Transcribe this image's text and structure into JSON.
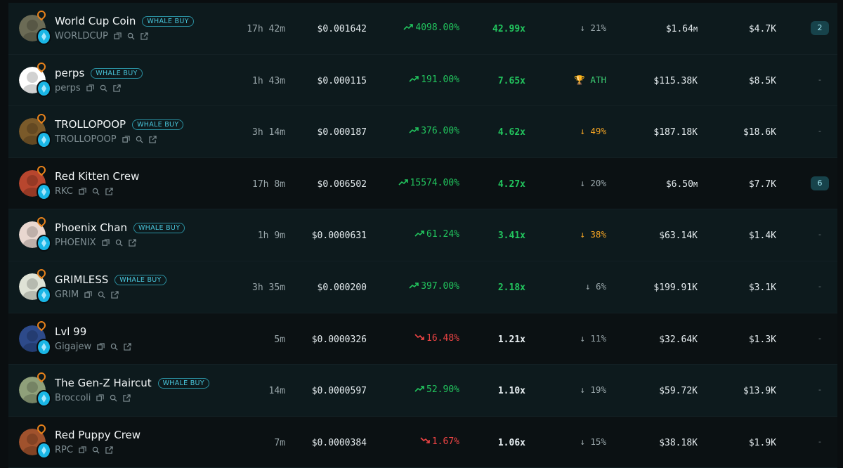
{
  "rows": [
    {
      "name": "World Cup Coin",
      "badge": "WHALE BUY",
      "ticker": "WORLDCUP",
      "age": "17h 42m",
      "price": "$0.001642",
      "change": "4098.00%",
      "dir": "up",
      "multiple": "42.99x",
      "mult_green": true,
      "drawdown": "↓ 21%",
      "dd_style": "gray",
      "mcap": "$1.64",
      "mcap_unit": "M",
      "volume": "$4.7K",
      "count": "2",
      "avatar_color": "#6b6b55",
      "tint": "tint"
    },
    {
      "name": "perps",
      "badge": "WHALE BUY",
      "ticker": "perps",
      "age": "1h 43m",
      "price": "$0.000115",
      "change": "191.00%",
      "dir": "up",
      "multiple": "7.65x",
      "mult_green": true,
      "drawdown": "🏆 ATH",
      "dd_style": "ath",
      "mcap": "$115.38K",
      "mcap_unit": "",
      "volume": "$8.5K",
      "count": "-",
      "avatar_color": "#ffffff",
      "tint": "tint"
    },
    {
      "name": "TROLLOPOOP",
      "badge": "WHALE BUY",
      "ticker": "TROLLOPOOP",
      "age": "3h 14m",
      "price": "$0.000187",
      "change": "376.00%",
      "dir": "up",
      "multiple": "4.62x",
      "mult_green": true,
      "drawdown": "↓ 49%",
      "dd_style": "amber",
      "mcap": "$187.18K",
      "mcap_unit": "",
      "volume": "$18.6K",
      "count": "-",
      "avatar_color": "#7a5a2a",
      "tint": "tint"
    },
    {
      "name": "Red Kitten Crew",
      "badge": "",
      "ticker": "RKC",
      "age": "17h 8m",
      "price": "$0.006502",
      "change": "15574.00%",
      "dir": "up",
      "multiple": "4.27x",
      "mult_green": true,
      "drawdown": "↓ 20%",
      "dd_style": "gray",
      "mcap": "$6.50",
      "mcap_unit": "M",
      "volume": "$7.7K",
      "count": "6",
      "avatar_color": "#b8462e",
      "tint": "dark"
    },
    {
      "name": "Phoenix Chan",
      "badge": "WHALE BUY",
      "ticker": "PHOENIX",
      "age": "1h 9m",
      "price": "$0.0000631",
      "change": "61.24%",
      "dir": "up",
      "multiple": "3.41x",
      "mult_green": true,
      "drawdown": "↓ 38%",
      "dd_style": "amber",
      "mcap": "$63.14K",
      "mcap_unit": "",
      "volume": "$1.4K",
      "count": "-",
      "avatar_color": "#e9d7d0",
      "tint": "tint"
    },
    {
      "name": "GRIMLESS",
      "badge": "WHALE BUY",
      "ticker": "GRIM",
      "age": "3h 35m",
      "price": "$0.000200",
      "change": "397.00%",
      "dir": "up",
      "multiple": "2.18x",
      "mult_green": true,
      "drawdown": "↓ 6%",
      "dd_style": "gray",
      "mcap": "$199.91K",
      "mcap_unit": "",
      "volume": "$3.1K",
      "count": "-",
      "avatar_color": "#dfe3d6",
      "tint": "tint"
    },
    {
      "name": "Lvl 99",
      "badge": "",
      "ticker": "Gigajew",
      "age": "5m",
      "price": "$0.0000326",
      "change": "16.48%",
      "dir": "down",
      "multiple": "1.21x",
      "mult_green": false,
      "drawdown": "↓ 11%",
      "dd_style": "gray",
      "mcap": "$32.64K",
      "mcap_unit": "",
      "volume": "$1.3K",
      "count": "-",
      "avatar_color": "#2d4a8a",
      "tint": "dark"
    },
    {
      "name": "The Gen-Z Haircut",
      "badge": "WHALE BUY",
      "ticker": "Broccoli",
      "age": "14m",
      "price": "$0.0000597",
      "change": "52.90%",
      "dir": "up",
      "multiple": "1.10x",
      "mult_green": false,
      "drawdown": "↓ 19%",
      "dd_style": "gray",
      "mcap": "$59.72K",
      "mcap_unit": "",
      "volume": "$13.9K",
      "count": "-",
      "avatar_color": "#8fa07a",
      "tint": "tint"
    },
    {
      "name": "Red Puppy Crew",
      "badge": "",
      "ticker": "RPC",
      "age": "7m",
      "price": "$0.0000384",
      "change": "1.67%",
      "dir": "down",
      "multiple": "1.06x",
      "mult_green": false,
      "drawdown": "↓ 15%",
      "dd_style": "gray",
      "mcap": "$38.18K",
      "mcap_unit": "",
      "volume": "$1.9K",
      "count": "-",
      "avatar_color": "#a0522d",
      "tint": "dark"
    }
  ],
  "icons": {
    "copy": "copy-icon",
    "search": "search-icon",
    "external": "external-link-icon",
    "trend_up": "trend-up-icon",
    "trend_down": "trend-down-icon",
    "chain": "chain-badge-icon",
    "flame": "flame-icon"
  },
  "colors": {
    "up": "#22c55e",
    "down": "#ef4444",
    "amber": "#f5a524",
    "accent": "#49c6dc"
  }
}
